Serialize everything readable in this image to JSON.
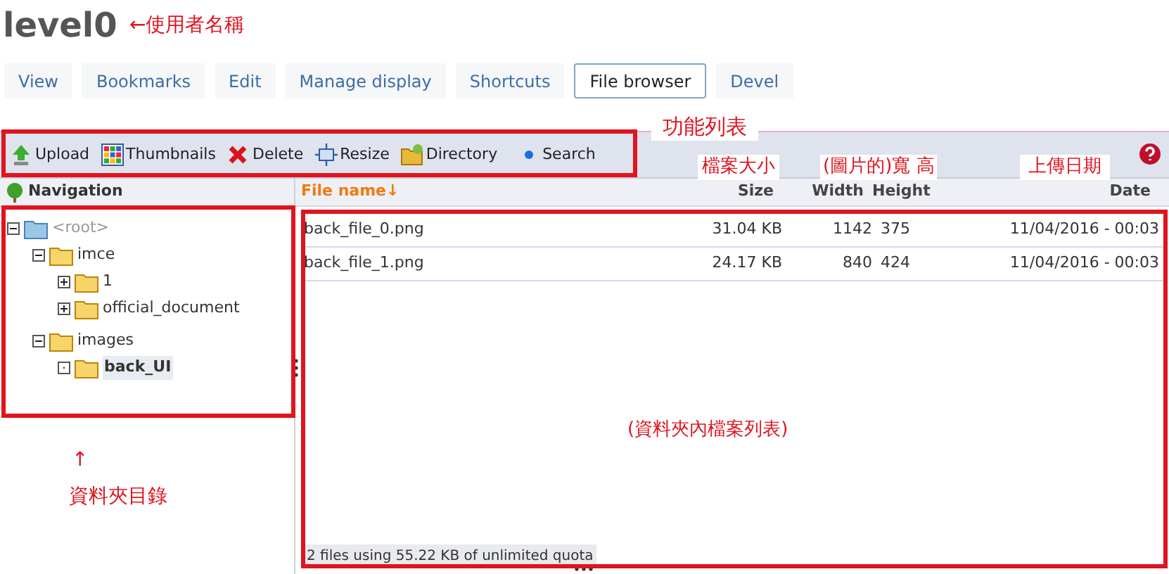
{
  "page_title": "level0",
  "tabs": [
    {
      "label": "View",
      "selected": false
    },
    {
      "label": "Bookmarks",
      "selected": false
    },
    {
      "label": "Edit",
      "selected": false
    },
    {
      "label": "Manage display",
      "selected": false
    },
    {
      "label": "Shortcuts",
      "selected": false
    },
    {
      "label": "File browser",
      "selected": true
    },
    {
      "label": "Devel",
      "selected": false
    }
  ],
  "toolbar": [
    {
      "label": "Upload",
      "kind": "upload"
    },
    {
      "label": "Thumbnails",
      "kind": "thumbnails"
    },
    {
      "label": "Delete",
      "kind": "delete"
    },
    {
      "label": "Resize",
      "kind": "resize"
    },
    {
      "label": "Directory",
      "kind": "directory"
    },
    {
      "label": "Search",
      "kind": "search"
    }
  ],
  "navigation": {
    "title": "Navigation",
    "tree": [
      {
        "label": "<root>",
        "has_children": true,
        "expanded": true,
        "muted": true,
        "selected": false,
        "children": [
          {
            "label": "imce",
            "has_children": true,
            "expanded": true,
            "muted": false,
            "selected": false,
            "children": [
              {
                "label": "1",
                "has_children": true,
                "expanded": false,
                "muted": false,
                "selected": false
              },
              {
                "label": "official_document",
                "has_children": true,
                "expanded": false,
                "muted": false,
                "selected": false
              }
            ]
          },
          {
            "label": "images",
            "has_children": true,
            "expanded": true,
            "muted": false,
            "selected": false,
            "children": [
              {
                "label": "back_UI",
                "has_children": false,
                "expanded": false,
                "muted": false,
                "selected": true
              }
            ]
          }
        ]
      }
    ]
  },
  "file_list": {
    "columns": [
      {
        "label": "File name↓",
        "sorted": true
      },
      {
        "label": "Size",
        "sorted": false
      },
      {
        "label": "Width",
        "sorted": false
      },
      {
        "label": "Height",
        "sorted": false
      },
      {
        "label": "Date",
        "sorted": false
      }
    ],
    "rows": [
      {
        "cells": [
          "back_file_0.png",
          "31.04 KB",
          "1142",
          "375",
          "11/04/2016 - 00:03"
        ]
      },
      {
        "cells": [
          "back_file_1.png",
          "24.17 KB",
          "840",
          "424",
          "11/04/2016 - 00:03"
        ]
      }
    ],
    "status": "2 files using 55.22 KB of unlimited quota"
  },
  "annotations": [
    "←使用者名稱",
    "功能列表",
    "檔案大小",
    "(圖片的)寬 高",
    "上傳日期",
    "(資料夾內檔案列表)",
    "↑",
    "資料夾目錄"
  ]
}
